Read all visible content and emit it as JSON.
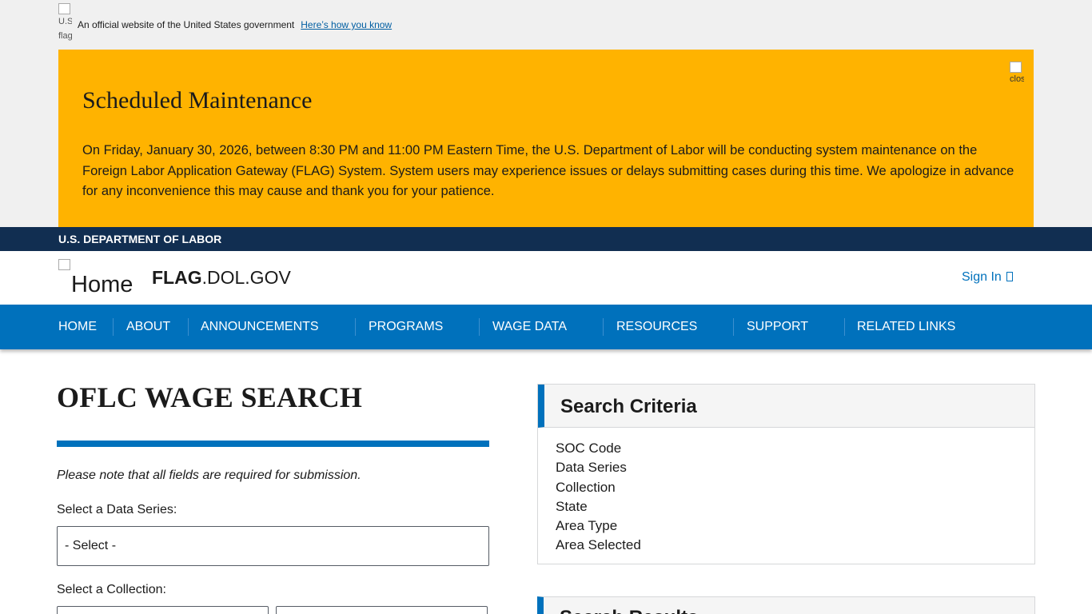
{
  "gov_banner": {
    "flag_alt": "U.S. flag",
    "official_text": "An official website of the United States government",
    "how_you_know_link": "Here’s how you know"
  },
  "alert": {
    "title": "Scheduled Maintenance",
    "body": "On Friday, January 30, 2026, between 8:30 PM and 11:00 PM Eastern Time, the U.S. Department of Labor will be conducting system maintenance on the Foreign Labor Application Gateway (FLAG) System. System users may experience issues or delays submitting cases during this time. We apologize in advance for any inconvenience this may cause and thank you for your patience.",
    "close_alt": "close",
    "background_color": "#ffb300"
  },
  "agency_strip": {
    "label": "U.S. DEPARTMENT OF LABOR",
    "background_color": "#112e51"
  },
  "header": {
    "logo_alt": "Home",
    "site_name_bold": "FLAG",
    "site_name_rest": ".DOL.GOV",
    "sign_in": "Sign In"
  },
  "nav": {
    "background_color": "#0071bc",
    "items": [
      "HOME",
      "ABOUT",
      "ANNOUNCEMENTS",
      "PROGRAMS",
      "WAGE DATA",
      "RESOURCES",
      "SUPPORT",
      "RELATED LINKS"
    ]
  },
  "main": {
    "title": "OFLC WAGE SEARCH",
    "note": "Please note that all fields are required for submission.",
    "data_series_label": "Select a Data Series:",
    "data_series_value": "- Select -",
    "collection_label": "Select a Collection:"
  },
  "criteria": {
    "heading": "Search Criteria",
    "items": [
      "SOC Code",
      "Data Series",
      "Collection",
      "State",
      "Area Type",
      "Area Selected"
    ]
  },
  "results": {
    "heading": "Search Results"
  }
}
